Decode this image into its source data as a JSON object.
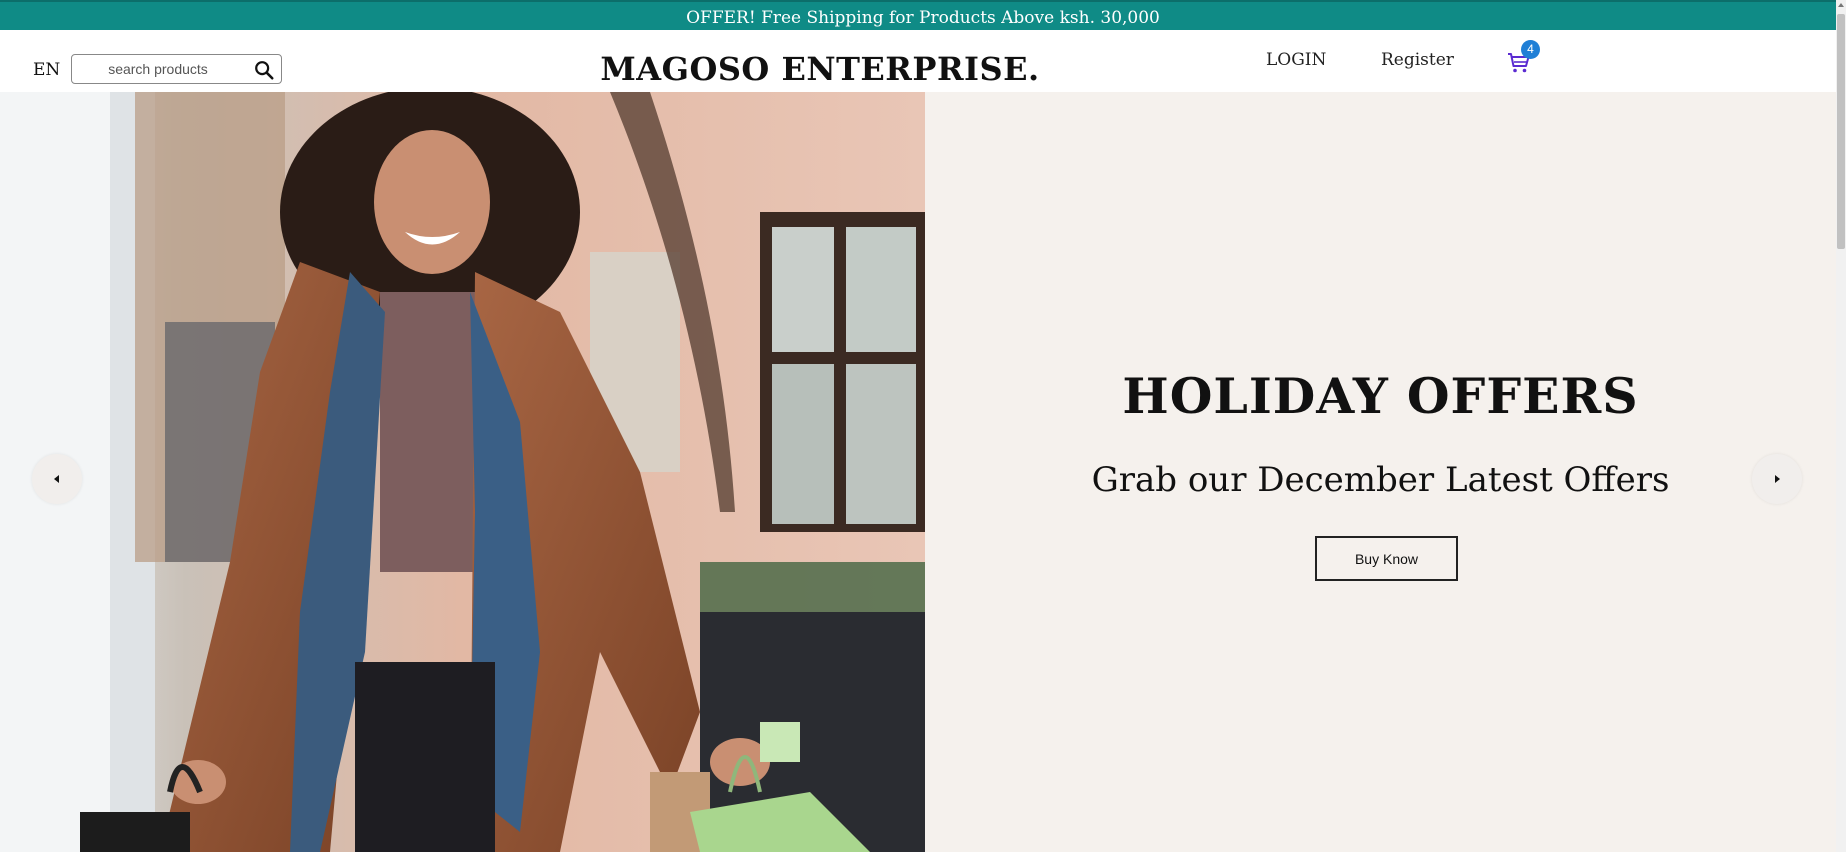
{
  "offer_bar": {
    "text": "OFFER! Free Shipping for Products Above ksh. 30,000",
    "color": "#0f8b86"
  },
  "header": {
    "language": "EN",
    "search": {
      "placeholder": "search products",
      "value": "",
      "icon": "search-icon"
    },
    "brand": "MAGOSO ENTERPRISE.",
    "nav": {
      "login": "LOGIN",
      "register": "Register"
    },
    "cart": {
      "icon": "cart-icon",
      "count": "4",
      "badge_color": "#1f7fd6"
    }
  },
  "hero": {
    "title": "HOLIDAY OFFERS",
    "subtitle": "Grab our December Latest Offers",
    "button_label": "Buy Know",
    "background": "#f5f1ed",
    "image": "woman-with-shopping-bags-photo",
    "prev_icon": "chevron-left-icon",
    "next_icon": "chevron-right-icon"
  }
}
